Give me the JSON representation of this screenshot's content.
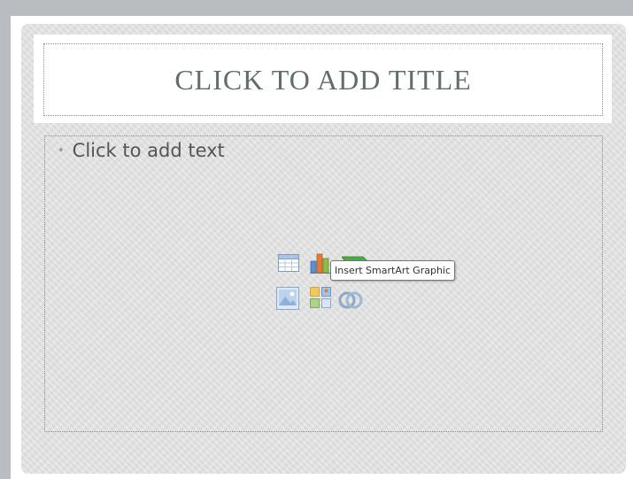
{
  "slide": {
    "title_placeholder": "CLICK TO ADD TITLE",
    "body_placeholder": "Click to add text",
    "bullet": "•"
  },
  "content_icons": [
    {
      "name": "insert-table-icon"
    },
    {
      "name": "insert-chart-icon"
    },
    {
      "name": "insert-smartart-icon"
    },
    {
      "name": "insert-picture-icon"
    },
    {
      "name": "insert-clip-art-icon"
    },
    {
      "name": "insert-media-clip-icon"
    }
  ],
  "tooltip": {
    "text": "Insert SmartArt Graphic"
  },
  "colors": {
    "slide_background": "#e3e3e3",
    "title_text": "#5f6e6c",
    "body_text": "#555555",
    "frame": "#b9bcc0"
  }
}
